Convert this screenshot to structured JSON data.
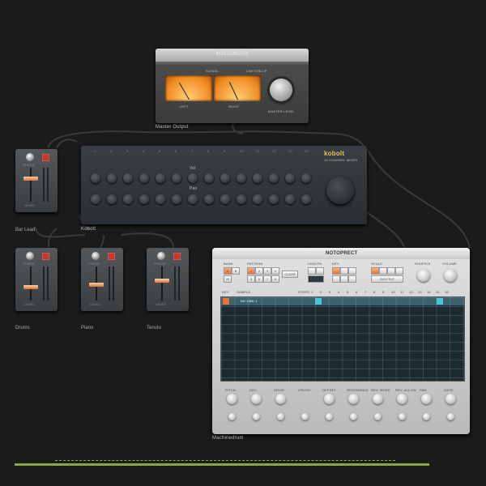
{
  "master": {
    "title": "KUSTOMIZER",
    "name": "Master Output",
    "meter_left": "LEFT",
    "meter_right": "RIGHT",
    "signal": "SIGNAL",
    "limiter": "LIMITER",
    "clip": "CLIP",
    "knob_label": "MASTER LEVEL"
  },
  "kobolt": {
    "brand": "kobolt",
    "subtitle": "16 CHANNEL MIXER",
    "name": "Kobolt",
    "row_a": "Vol",
    "row_b": "Pan",
    "channel_numbers": [
      "1",
      "2",
      "3",
      "4",
      "5",
      "6",
      "7",
      "8",
      "9",
      "10",
      "11",
      "12",
      "13",
      "14"
    ]
  },
  "strips": [
    {
      "name": "Bar Lead",
      "top_label": "PHASE",
      "bottom_label": "LEVEL",
      "fader": 0.7
    },
    {
      "name": "Drums",
      "top_label": "PHASE",
      "bottom_label": "LEVEL",
      "fader": 0.4
    },
    {
      "name": "Piano",
      "top_label": "PHASE",
      "bottom_label": "LEVEL",
      "fader": 0.5
    },
    {
      "name": "Tenuto",
      "top_label": "PHASE",
      "bottom_label": "LEVEL",
      "fader": 0.25
    }
  ],
  "machinedrum": {
    "title": "NOTOPRECT",
    "name": "Machinedrum",
    "sections": [
      "BANK",
      "PATTERN",
      "LENGTH",
      "KEY",
      "SCALE",
      "SHUFFLE",
      "VOLUME"
    ],
    "pattern_buttons": [
      "1",
      "2",
      "3",
      "4",
      "5",
      "6",
      "7",
      "8"
    ],
    "clear": "CLEAR",
    "shuffle": "SHUFFLE",
    "row_labels": [
      "KEY",
      "SAMPLE",
      "STEPS"
    ],
    "step_numbers": [
      "1",
      "2",
      "3",
      "4",
      "5",
      "6",
      "7",
      "8",
      "9",
      "10",
      "11",
      "12",
      "13",
      "14",
      "15",
      "16"
    ],
    "track_name": "BD 1/BD 1",
    "knob_labels": [
      "PITCH",
      "DEC",
      "DRIVE",
      "CRUSH",
      "OFFSET",
      "RESONANCE",
      "REV. MODE",
      "REV. ALLOW",
      "PAN",
      "GATE"
    ],
    "mode_labels": [
      "A",
      "B",
      "M"
    ]
  },
  "timeline": {
    "color": "#9ad14b"
  }
}
